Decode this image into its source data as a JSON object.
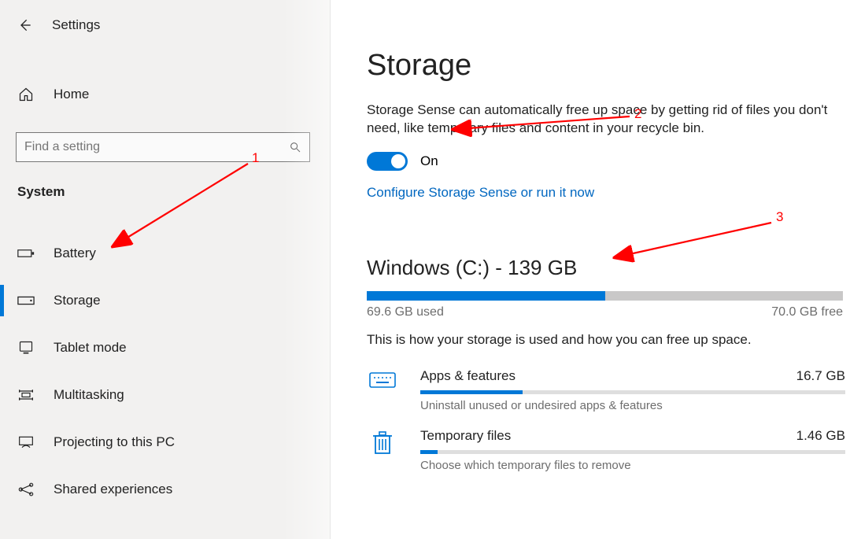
{
  "header": {
    "settings_label": "Settings"
  },
  "sidebar": {
    "home_label": "Home",
    "search_placeholder": "Find a setting",
    "section_label": "System",
    "items": [
      {
        "label": "Battery"
      },
      {
        "label": "Storage"
      },
      {
        "label": "Tablet mode"
      },
      {
        "label": "Multitasking"
      },
      {
        "label": "Projecting to this PC"
      },
      {
        "label": "Shared experiences"
      }
    ],
    "selected_index": 1
  },
  "main": {
    "title": "Storage",
    "sense_description": "Storage Sense can automatically free up space by getting rid of files you don't need, like temporary files and content in your recycle bin.",
    "toggle_on": true,
    "toggle_label": "On",
    "configure_link": "Configure Storage Sense or run it now",
    "drive": {
      "title": "Windows (C:) - 139 GB",
      "used_label": "69.6 GB used",
      "free_label": "70.0 GB free",
      "used_percent": 50,
      "usage_description": "This is how your storage is used and how you can free up space."
    },
    "categories": [
      {
        "name": "Apps & features",
        "size": "16.7 GB",
        "percent": 24,
        "sub": "Uninstall unused or undesired apps & features",
        "icon": "keyboard-icon"
      },
      {
        "name": "Temporary files",
        "size": "1.46 GB",
        "percent": 4,
        "sub": "Choose which temporary files to remove",
        "icon": "trash-icon"
      }
    ]
  },
  "annotations": {
    "a1": "1",
    "a2": "2",
    "a3": "3"
  },
  "colors": {
    "accent": "#0078d7",
    "link": "#0067c0",
    "red": "#f00"
  }
}
